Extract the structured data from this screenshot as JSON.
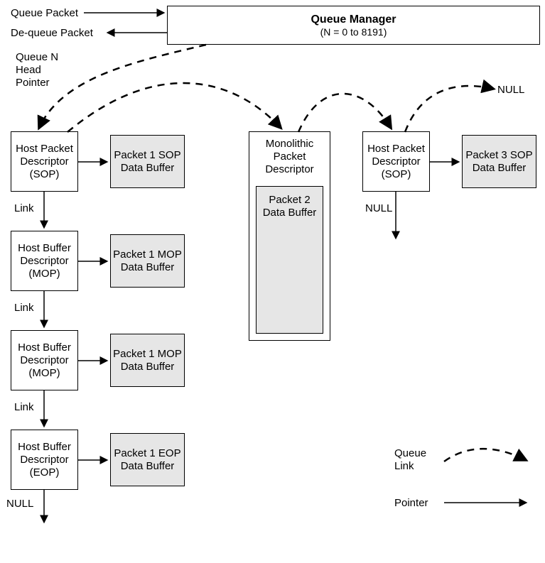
{
  "queue_manager": {
    "title": "Queue Manager",
    "subtitle": "(N = 0 to 8191)"
  },
  "io": {
    "queue_packet": "Queue Packet",
    "dequeue_packet": "De-queue Packet",
    "head_pointer": "Queue N\nHead\nPointer"
  },
  "links": {
    "link": "Link",
    "null": "NULL"
  },
  "col1": {
    "d0": "Host\nPacket\nDescriptor\n(SOP)",
    "b0": "Packet 1\nSOP Data\nBuffer",
    "d1": "Host\nBuffer\nDescriptor\n(MOP)",
    "b1": "Packet 1\nMOP Data\nBuffer",
    "d2": "Host\nBuffer\nDescriptor\n(MOP)",
    "b2": "Packet 1\nMOP Data\nBuffer",
    "d3": "Host\nBuffer\nDescriptor\n(EOP)",
    "b3": "Packet 1\nEOP Data\nBuffer"
  },
  "col2": {
    "outer": "Monolithic\nPacket\nDescriptor",
    "inner": "Packet 2\nData\nBuffer"
  },
  "col3": {
    "d0": "Host\nPacket\nDescriptor\n(SOP)",
    "b0": "Packet 3\nSOP Data\nBuffer"
  },
  "legend": {
    "queue_link": "Queue\nLink",
    "pointer": "Pointer"
  }
}
